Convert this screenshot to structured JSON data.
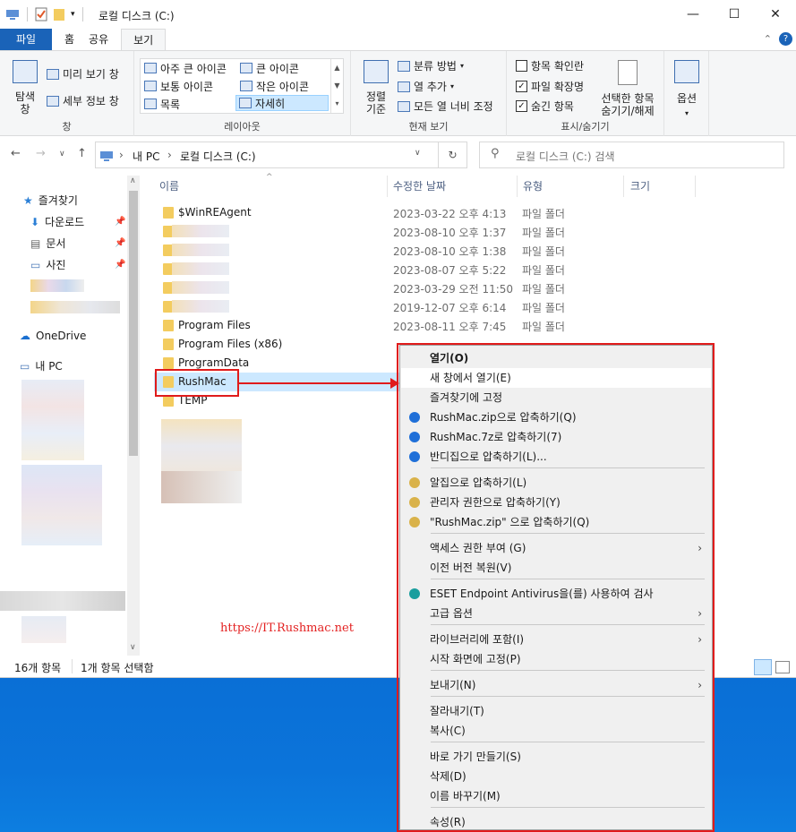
{
  "window": {
    "title": "로컬 디스크 (C:)",
    "controls": {
      "minimize": "—",
      "maximize": "☐",
      "close": "✕"
    }
  },
  "ribbon_tabs": [
    "파일",
    "홈",
    "공유",
    "보기"
  ],
  "ribbon": {
    "pane_group": {
      "nav_pane_label": "탐색\n창",
      "preview": "미리 보기 창",
      "details": "세부 정보 창",
      "label": "창"
    },
    "layout_group": {
      "items": [
        "아주 큰 아이콘",
        "큰 아이콘",
        "보통 아이콘",
        "작은 아이콘",
        "목록",
        "자세히"
      ],
      "label": "레이아웃"
    },
    "current_view_group": {
      "sort_label": "정렬\n기준",
      "group_by": "분류 방법",
      "add_column": "열 추가",
      "fit_columns": "모든 열 너비 조정",
      "label": "현재 보기"
    },
    "showhide_group": {
      "item_checkbox": "항목 확인란",
      "file_ext": "파일 확장명",
      "hidden_items": "숨긴 항목",
      "hide_selected": "선택한 항목\n숨기기/해제",
      "label": "표시/숨기기"
    },
    "options_label": "옵션"
  },
  "address": {
    "breadcrumb": [
      "내 PC",
      "로컬 디스크 (C:)"
    ],
    "search_placeholder": "로컬 디스크 (C:) 검색"
  },
  "navpane": {
    "quick_access": "즐겨찾기",
    "pinned": [
      "다운로드",
      "문서",
      "사진"
    ],
    "onedrive": "OneDrive",
    "this_pc": "내 PC"
  },
  "columns": {
    "name": "이름",
    "modified": "수정한 날짜",
    "type": "유형",
    "size": "크기"
  },
  "files": [
    {
      "name": "$WinREAgent",
      "date": "2023-03-22 오후 4:13",
      "type": "파일 폴더"
    },
    {
      "name": "",
      "date": "2023-08-10 오후 1:37",
      "type": "파일 폴더"
    },
    {
      "name": "",
      "date": "2023-08-10 오후 1:38",
      "type": "파일 폴더"
    },
    {
      "name": "",
      "date": "2023-08-07 오후 5:22",
      "type": "파일 폴더"
    },
    {
      "name": "",
      "date": "2023-03-29 오전 11:50",
      "type": "파일 폴더"
    },
    {
      "name": "",
      "date": "2019-12-07 오후 6:14",
      "type": "파일 폴더"
    },
    {
      "name": "Program Files",
      "date": "2023-08-11 오후 7:45",
      "type": "파일 폴더"
    },
    {
      "name": "Program Files (x86)",
      "date": "",
      "type": ""
    },
    {
      "name": "ProgramData",
      "date": "",
      "type": ""
    },
    {
      "name": "RushMac",
      "date": "",
      "type": ""
    },
    {
      "name": "TEMP",
      "date": "",
      "type": ""
    }
  ],
  "status": {
    "count": "16개 항목",
    "selected": "1개 항목 선택함"
  },
  "context_menu": {
    "items": [
      {
        "label": "열기(O)",
        "bold": true
      },
      {
        "label": "새 창에서 열기(E)"
      },
      {
        "label": "즐겨찾기에 고정"
      },
      {
        "label": "RushMac.zip으로 압축하기(Q)"
      },
      {
        "label": "RushMac.7z로 압축하기(7)"
      },
      {
        "label": "반디집으로 압축하기(L)..."
      },
      {
        "label": "알집으로 압축하기(L)"
      },
      {
        "label": "관리자 권한으로 압축하기(Y)"
      },
      {
        "label": "\"RushMac.zip\" 으로 압축하기(Q)"
      },
      {
        "label": "액세스 권한 부여 (G)"
      },
      {
        "label": "이전 버전 복원(V)"
      },
      {
        "label": "ESET Endpoint Antivirus을(를) 사용하여 검사"
      },
      {
        "label": "고급 옵션"
      },
      {
        "label": "라이브러리에 포함(I)"
      },
      {
        "label": "시작 화면에 고정(P)"
      },
      {
        "label": "보내기(N)"
      },
      {
        "label": "잘라내기(T)"
      },
      {
        "label": "복사(C)"
      },
      {
        "label": "바로 가기 만들기(S)"
      },
      {
        "label": "삭제(D)"
      },
      {
        "label": "이름 바꾸기(M)"
      },
      {
        "label": "속성(R)"
      }
    ]
  },
  "watermark": "https://IT.Rushmac.net",
  "colors": {
    "accent": "#1a63b8",
    "selection": "#cce8ff",
    "annotation": "#e01b1b",
    "folder": "#f3cc5f"
  }
}
